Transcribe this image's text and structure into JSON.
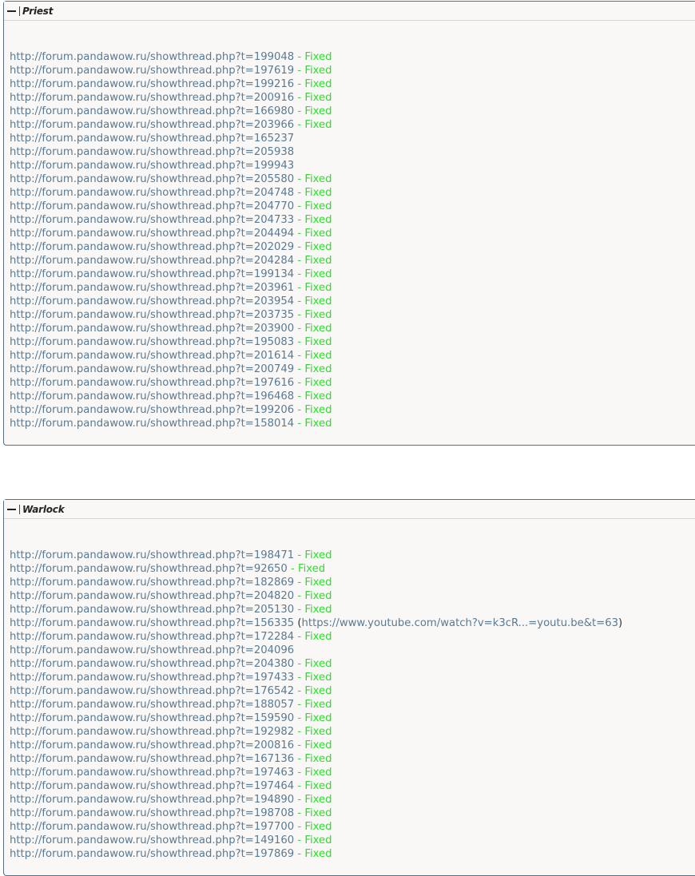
{
  "colors": {
    "link": "#5a7a94",
    "fixed": "#2ddc2d",
    "border": "#5a6e82",
    "panel_bg": "#f9f8f6"
  },
  "fixed_label": " - Fixed",
  "sections": [
    {
      "title": "Priest",
      "items": [
        {
          "url": "http://forum.pandawow.ru/showthread.php?t=199048",
          "status": " - Fixed"
        },
        {
          "url": "http://forum.pandawow.ru/showthread.php?t=197619",
          "status": " - Fixed"
        },
        {
          "url": "http://forum.pandawow.ru/showthread.php?t=199216",
          "status": " - Fixed"
        },
        {
          "url": "http://forum.pandawow.ru/showthread.php?t=200916",
          "status": " - Fixed"
        },
        {
          "url": "http://forum.pandawow.ru/showthread.php?t=166980",
          "status": " - Fixed"
        },
        {
          "url": "http://forum.pandawow.ru/showthread.php?t=203966",
          "status": " - Fixed"
        },
        {
          "url": "http://forum.pandawow.ru/showthread.php?t=165237",
          "status": ""
        },
        {
          "url": "http://forum.pandawow.ru/showthread.php?t=205938",
          "status": ""
        },
        {
          "url": "http://forum.pandawow.ru/showthread.php?t=199943",
          "status": ""
        },
        {
          "url": "http://forum.pandawow.ru/showthread.php?t=205580",
          "status": " - Fixed"
        },
        {
          "url": "http://forum.pandawow.ru/showthread.php?t=204748",
          "status": " - Fixed"
        },
        {
          "url": "http://forum.pandawow.ru/showthread.php?t=204770",
          "status": " - Fixed"
        },
        {
          "url": "http://forum.pandawow.ru/showthread.php?t=204733",
          "status": " - Fixed"
        },
        {
          "url": "http://forum.pandawow.ru/showthread.php?t=204494",
          "status": " - Fixed"
        },
        {
          "url": "http://forum.pandawow.ru/showthread.php?t=202029",
          "status": " - Fixed"
        },
        {
          "url": "http://forum.pandawow.ru/showthread.php?t=204284",
          "status": " - Fixed"
        },
        {
          "url": "http://forum.pandawow.ru/showthread.php?t=199134",
          "status": " - Fixed"
        },
        {
          "url": "http://forum.pandawow.ru/showthread.php?t=203961",
          "status": " - Fixed"
        },
        {
          "url": "http://forum.pandawow.ru/showthread.php?t=203954",
          "status": " - Fixed"
        },
        {
          "url": "http://forum.pandawow.ru/showthread.php?t=203735",
          "status": " - Fixed"
        },
        {
          "url": "http://forum.pandawow.ru/showthread.php?t=203900",
          "status": " - Fixed"
        },
        {
          "url": "http://forum.pandawow.ru/showthread.php?t=195083",
          "status": " - Fixed"
        },
        {
          "url": "http://forum.pandawow.ru/showthread.php?t=201614",
          "status": " - Fixed"
        },
        {
          "url": "http://forum.pandawow.ru/showthread.php?t=200749",
          "status": " - Fixed"
        },
        {
          "url": "http://forum.pandawow.ru/showthread.php?t=197616",
          "status": " - Fixed"
        },
        {
          "url": "http://forum.pandawow.ru/showthread.php?t=196468",
          "status": " - Fixed"
        },
        {
          "url": "http://forum.pandawow.ru/showthread.php?t=199206",
          "status": " - Fixed"
        },
        {
          "url": "http://forum.pandawow.ru/showthread.php?t=158014",
          "status": " - Fixed"
        }
      ]
    },
    {
      "title": "Warlock",
      "items": [
        {
          "url": "http://forum.pandawow.ru/showthread.php?t=198471",
          "status": " - Fixed"
        },
        {
          "url": "http://forum.pandawow.ru/showthread.php?t=92650",
          "status": " - Fixed"
        },
        {
          "url": "http://forum.pandawow.ru/showthread.php?t=182869",
          "status": " - Fixed"
        },
        {
          "url": "http://forum.pandawow.ru/showthread.php?t=204820",
          "status": " - Fixed"
        },
        {
          "url": "http://forum.pandawow.ru/showthread.php?t=205130",
          "status": " - Fixed"
        },
        {
          "url": "http://forum.pandawow.ru/showthread.php?t=156335",
          "status": "",
          "extra_open": " (",
          "extra_link": "https://www.youtube.com/watch?v=k3cR...=youtu.be&t=63",
          "extra_close": ")"
        },
        {
          "url": "http://forum.pandawow.ru/showthread.php?t=172284",
          "status": " - Fixed"
        },
        {
          "url": "http://forum.pandawow.ru/showthread.php?t=204096",
          "status": ""
        },
        {
          "url": "http://forum.pandawow.ru/showthread.php?t=204380",
          "status": " - Fixed"
        },
        {
          "url": "http://forum.pandawow.ru/showthread.php?t=197433",
          "status": " - Fixed"
        },
        {
          "url": "http://forum.pandawow.ru/showthread.php?t=176542",
          "status": " - Fixed"
        },
        {
          "url": "http://forum.pandawow.ru/showthread.php?t=188057",
          "status": " - Fixed"
        },
        {
          "url": "http://forum.pandawow.ru/showthread.php?t=159590",
          "status": " - Fixed"
        },
        {
          "url": "http://forum.pandawow.ru/showthread.php?t=192982",
          "status": " - Fixed"
        },
        {
          "url": "http://forum.pandawow.ru/showthread.php?t=200816",
          "status": " - Fixed"
        },
        {
          "url": "http://forum.pandawow.ru/showthread.php?t=167136",
          "status": " - Fixed"
        },
        {
          "url": "http://forum.pandawow.ru/showthread.php?t=197463",
          "status": " - Fixed"
        },
        {
          "url": "http://forum.pandawow.ru/showthread.php?t=197464",
          "status": " - Fixed"
        },
        {
          "url": "http://forum.pandawow.ru/showthread.php?t=194890",
          "status": " - Fixed"
        },
        {
          "url": "http://forum.pandawow.ru/showthread.php?t=198708",
          "status": " - Fixed"
        },
        {
          "url": "http://forum.pandawow.ru/showthread.php?t=197700",
          "status": " - Fixed"
        },
        {
          "url": "http://forum.pandawow.ru/showthread.php?t=149160",
          "status": " - Fixed"
        },
        {
          "url": "http://forum.pandawow.ru/showthread.php?t=197869",
          "status": " - Fixed"
        }
      ]
    }
  ]
}
